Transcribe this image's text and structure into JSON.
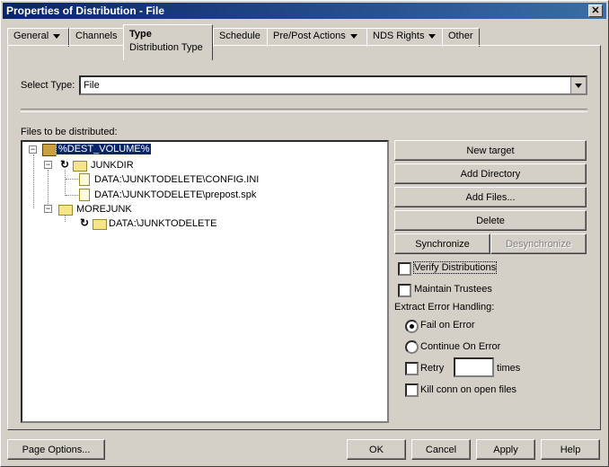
{
  "window": {
    "title": "Properties of Distribution - File",
    "close": "✕"
  },
  "tabs": [
    {
      "label": "General",
      "has_menu": true
    },
    {
      "label": "Channels",
      "has_menu": false
    },
    {
      "label": "Type",
      "sublabel": "Distribution Type",
      "active": true
    },
    {
      "label": "Schedule",
      "has_menu": false
    },
    {
      "label": "Pre/Post Actions",
      "has_menu": true
    },
    {
      "label": "NDS Rights",
      "has_menu": true
    },
    {
      "label": "Other",
      "has_menu": false
    }
  ],
  "select_type": {
    "label": "Select Type:",
    "value": "File"
  },
  "files_label": "Files to be distributed:",
  "tree": [
    {
      "label": "%DEST_VOLUME%",
      "icon": "volume-icon",
      "selected": true
    },
    {
      "label": "JUNKDIR",
      "icon": "folder-icon",
      "sync": true
    },
    {
      "label": "DATA:\\JUNKTODELETE\\CONFIG.INI",
      "icon": "file-icon"
    },
    {
      "label": "DATA:\\JUNKTODELETE\\prepost.spk",
      "icon": "file-icon"
    },
    {
      "label": "MOREJUNK",
      "icon": "folder-icon"
    },
    {
      "label": "DATA:\\JUNKTODELETE",
      "icon": "folder-icon",
      "sync": true
    }
  ],
  "buttons": {
    "new_target": "New target",
    "add_directory": "Add Directory",
    "add_files": "Add Files...",
    "delete": "Delete",
    "synchronize": "Synchronize",
    "desynchronize": "Desynchronize"
  },
  "options": {
    "verify": {
      "label": "Verify Distributions",
      "checked": false
    },
    "maintain": {
      "label": "Maintain Trustees",
      "checked": false
    },
    "extract_label": "Extract Error Handling:",
    "fail": {
      "label": "Fail on Error",
      "selected": true
    },
    "continue": {
      "label": "Continue On Error",
      "selected": false
    },
    "retry": {
      "label": "Retry",
      "checked": false,
      "value": "",
      "suffix": "times"
    },
    "kill": {
      "label": "Kill conn on open files",
      "checked": false
    }
  },
  "footer": {
    "page_options": "Page Options...",
    "ok": "OK",
    "cancel": "Cancel",
    "apply": "Apply",
    "help": "Help"
  }
}
